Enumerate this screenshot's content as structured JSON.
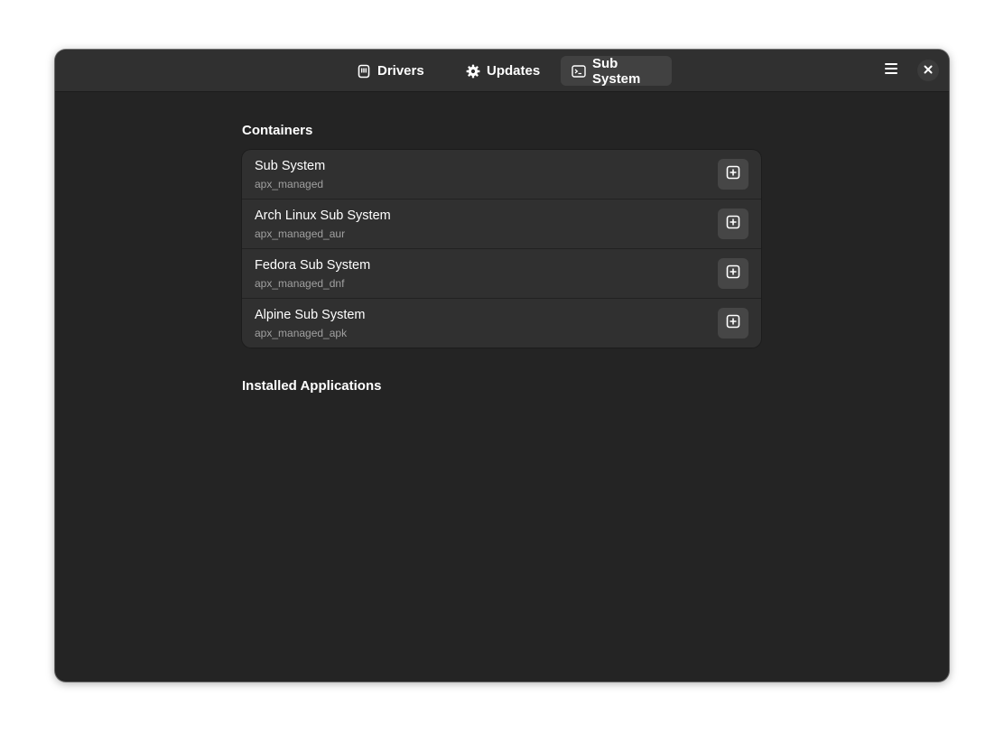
{
  "header": {
    "tabs": [
      {
        "label": "Drivers",
        "icon": "memory-chip-icon",
        "active": false
      },
      {
        "label": "Updates",
        "icon": "gear-icon",
        "active": false
      },
      {
        "label": "Sub System",
        "icon": "terminal-icon",
        "active": true
      }
    ],
    "menu_icon": "hamburger-menu-icon",
    "close_icon": "close-icon"
  },
  "main": {
    "containers_title": "Containers",
    "containers": [
      {
        "title": "Sub System",
        "subtitle": "apx_managed"
      },
      {
        "title": "Arch Linux Sub System",
        "subtitle": "apx_managed_aur"
      },
      {
        "title": "Fedora Sub System",
        "subtitle": "apx_managed_dnf"
      },
      {
        "title": "Alpine Sub System",
        "subtitle": "apx_managed_apk"
      }
    ],
    "apps_title": "Installed Applications"
  },
  "colors": {
    "window_bg": "#242424",
    "headerbar_bg": "#303030",
    "list_bg": "#303030",
    "active_tab_bg": "#414141",
    "button_bg": "#464646",
    "text": "#ffffff",
    "subtext": "#a0a0a0"
  }
}
